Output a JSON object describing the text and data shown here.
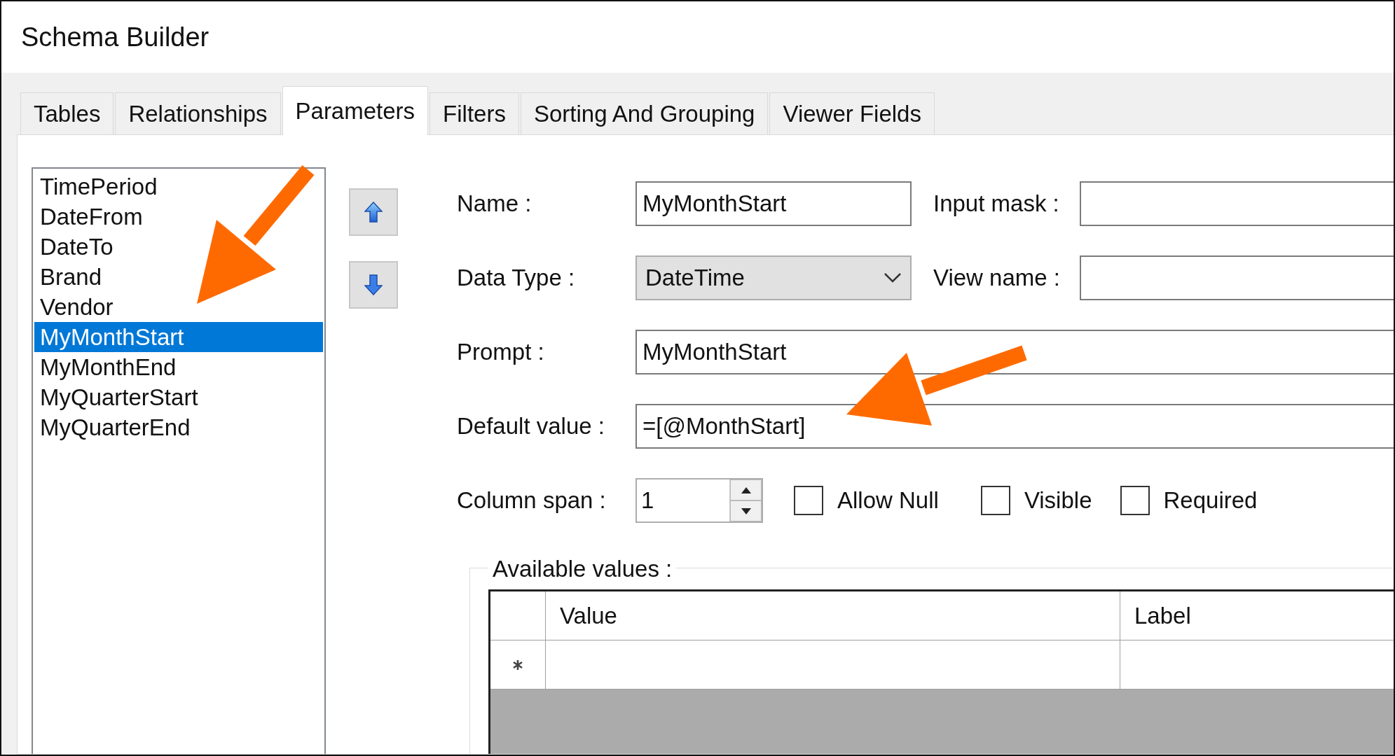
{
  "window": {
    "title": "Schema Builder"
  },
  "tabs": [
    {
      "label": "Tables",
      "selected": false
    },
    {
      "label": "Relationships",
      "selected": false
    },
    {
      "label": "Parameters",
      "selected": true
    },
    {
      "label": "Filters",
      "selected": false
    },
    {
      "label": "Sorting And Grouping",
      "selected": false
    },
    {
      "label": "Viewer Fields",
      "selected": false
    }
  ],
  "parameter_list": [
    {
      "label": "TimePeriod",
      "selected": false
    },
    {
      "label": "DateFrom",
      "selected": false
    },
    {
      "label": "DateTo",
      "selected": false
    },
    {
      "label": "Brand",
      "selected": false
    },
    {
      "label": "Vendor",
      "selected": false
    },
    {
      "label": "MyMonthStart",
      "selected": true
    },
    {
      "label": "MyMonthEnd",
      "selected": false
    },
    {
      "label": "MyQuarterStart",
      "selected": false
    },
    {
      "label": "MyQuarterEnd",
      "selected": false
    }
  ],
  "form": {
    "name": {
      "label": "Name :",
      "value": "MyMonthStart"
    },
    "input_mask": {
      "label": "Input mask :"
    },
    "data_type": {
      "label": "Data Type :",
      "value": "DateTime"
    },
    "view_name": {
      "label": "View name :"
    },
    "prompt": {
      "label": "Prompt :",
      "value": "MyMonthStart"
    },
    "default_value": {
      "label": "Default value :",
      "value": "=[@MonthStart]"
    },
    "column_span": {
      "label": "Column span :",
      "value": "1"
    },
    "checkboxes": [
      {
        "label": "Allow Null",
        "checked": false
      },
      {
        "label": "Visible",
        "checked": false
      },
      {
        "label": "Required",
        "checked": false
      }
    ]
  },
  "available_values": {
    "title": "Available values :",
    "columns": [
      "Value",
      "Label"
    ]
  }
}
